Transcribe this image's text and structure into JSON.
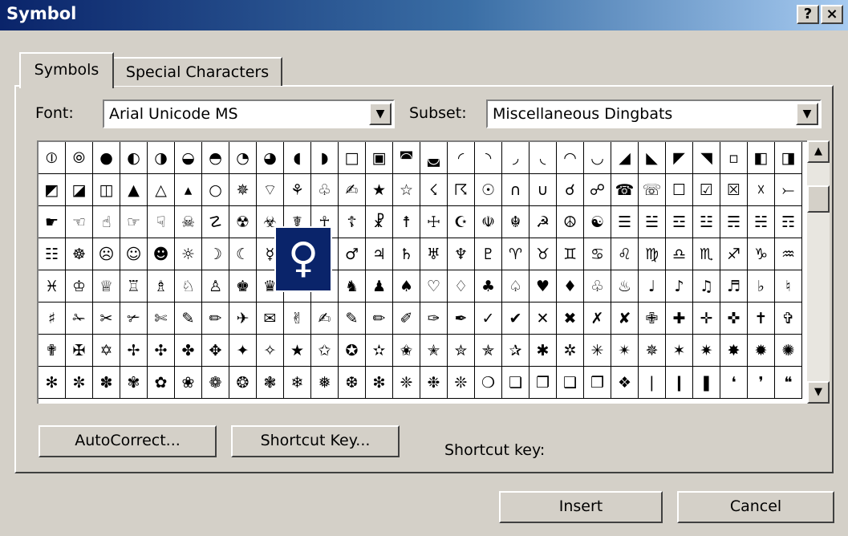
{
  "window": {
    "title": "Symbol",
    "help_label": "?",
    "close_label": "×"
  },
  "tabs": [
    {
      "label": "Symbols",
      "active": true
    },
    {
      "label": "Special Characters",
      "active": false
    }
  ],
  "font": {
    "label": "Font:",
    "value": "Arial Unicode MS"
  },
  "subset": {
    "label": "Subset:",
    "value": "Miscellaneous Dingbats"
  },
  "dropdown_icon": "▼",
  "scroll": {
    "up": "▲",
    "down": "▼"
  },
  "symbols_grid": [
    [
      "⦶",
      "⦾",
      "●",
      "◐",
      "◑",
      "◒",
      "◓",
      "◔",
      "◕",
      "◖",
      "◗",
      "□",
      "▣",
      "◚",
      "◛",
      "◜",
      "◝",
      "◞",
      "◟",
      "◠",
      "◡",
      "◢",
      "◣",
      "◤",
      "◥",
      "▫",
      "◧",
      "◨"
    ],
    [
      "◩",
      "◪",
      "◫",
      "▲",
      "△",
      "▴",
      "○",
      "✵",
      "⌔",
      "⚘",
      "♧",
      "✍",
      "★",
      "☆",
      "☇",
      "☈",
      "☉",
      "∩",
      "∪",
      "☌",
      "☍",
      "☎",
      "☏",
      "☐",
      "☑",
      "☒",
      "☓",
      "⤚"
    ],
    [
      "☛",
      "☜",
      "☝",
      "☞",
      "☟",
      "☠",
      "☡",
      "☢",
      "☣",
      "☤",
      "☥",
      "☦",
      "☧",
      "☨",
      "☩",
      "☪",
      "☫",
      "☬",
      "☭",
      "☮",
      "☯",
      "☰",
      "☱",
      "☲",
      "☳",
      "☴",
      "☵",
      "☶"
    ],
    [
      "☷",
      "☸",
      "☹",
      "☺",
      "☻",
      "☼",
      "☽",
      "☾",
      "☿",
      "♀",
      "♁",
      "♂",
      "♃",
      "♄",
      "♅",
      "♆",
      "♇",
      "♈",
      "♉",
      "♊",
      "♋",
      "♌",
      "♍",
      "♎",
      "♏",
      "♐",
      "♑",
      "♒"
    ],
    [
      "♓",
      "♔",
      "♕",
      "♖",
      "♗",
      "♘",
      "♙",
      "♚",
      "♛",
      "♜",
      "♝",
      "♞",
      "♟",
      "♠",
      "♡",
      "♢",
      "♣",
      "♤",
      "♥",
      "♦",
      "♧",
      "♨",
      "♩",
      "♪",
      "♫",
      "♬",
      "♭",
      "♮"
    ],
    [
      "♯",
      "✁",
      "✂",
      "✃",
      "✄",
      "✎",
      "✏",
      "✈",
      "✉",
      "✌",
      "✍",
      "✎",
      "✏",
      "✐",
      "✑",
      "✒",
      "✓",
      "✔",
      "✕",
      "✖",
      "✗",
      "✘",
      "✙",
      "✚",
      "✛",
      "✜",
      "✝",
      "✞"
    ],
    [
      "✟",
      "✠",
      "✡",
      "✢",
      "✣",
      "✤",
      "✥",
      "✦",
      "✧",
      "★",
      "✩",
      "✪",
      "✫",
      "✬",
      "✭",
      "✮",
      "✯",
      "✰",
      "✱",
      "✲",
      "✳",
      "✴",
      "✵",
      "✶",
      "✷",
      "✸",
      "✹",
      "✺"
    ],
    [
      "✻",
      "✼",
      "✽",
      "✾",
      "✿",
      "❀",
      "❁",
      "❂",
      "❃",
      "❄",
      "❅",
      "❆",
      "❇",
      "❈",
      "❉",
      "❊",
      "❍",
      "❏",
      "❐",
      "❑",
      "❒",
      "❖",
      "❘",
      "❙",
      "❚",
      "❛",
      "❜",
      "❝"
    ]
  ],
  "selected_symbol": {
    "glyph": "♀",
    "row": 3,
    "col": 9
  },
  "buttons": {
    "autocorrect": "AutoCorrect...",
    "shortcut_key": "Shortcut Key...",
    "insert": "Insert",
    "cancel": "Cancel"
  },
  "shortcut_label": "Shortcut key:"
}
